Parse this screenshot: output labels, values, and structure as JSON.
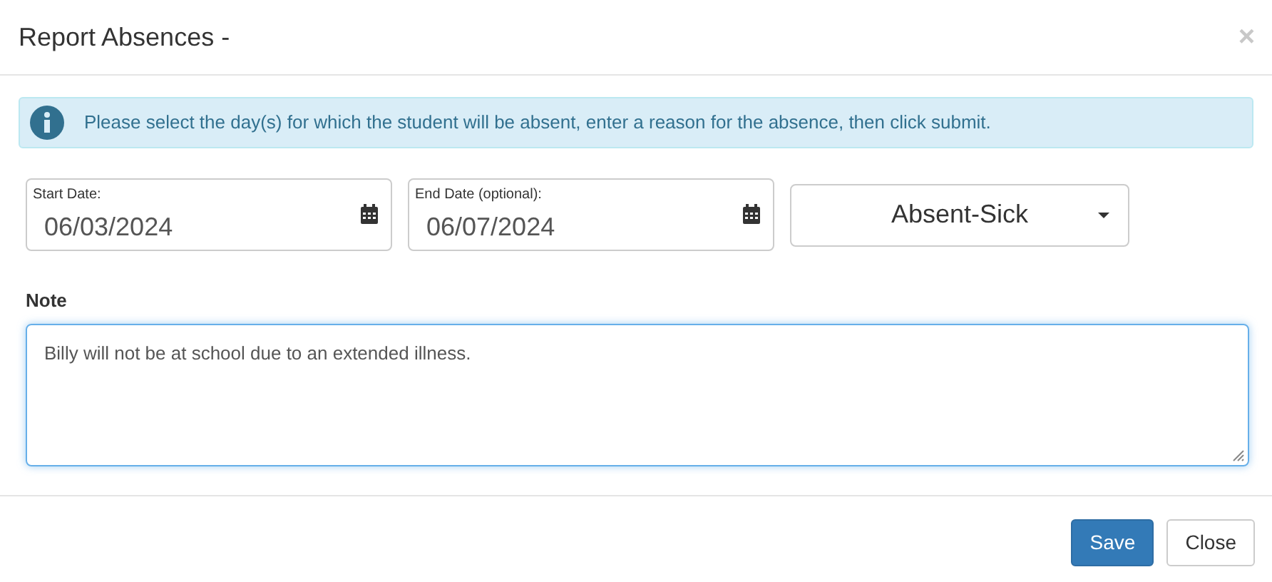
{
  "dialog": {
    "title": "Report Absences -",
    "close_symbol": "×"
  },
  "alert": {
    "message": "Please select the day(s) for which the student will be absent, enter a reason for the absence, then click submit."
  },
  "dates": [
    {
      "label": "Start Date:",
      "value": "06/03/2024"
    },
    {
      "label": "End Date (optional):",
      "value": "06/07/2024"
    }
  ],
  "reason": {
    "value": "Absent-Sick"
  },
  "note": {
    "label": "Note",
    "value": "Billy will not be at school due to an extended illness.",
    "focused": true
  },
  "buttons": [
    {
      "label": "Save",
      "kind": "primary"
    },
    {
      "label": "Close",
      "kind": "default"
    }
  ]
}
